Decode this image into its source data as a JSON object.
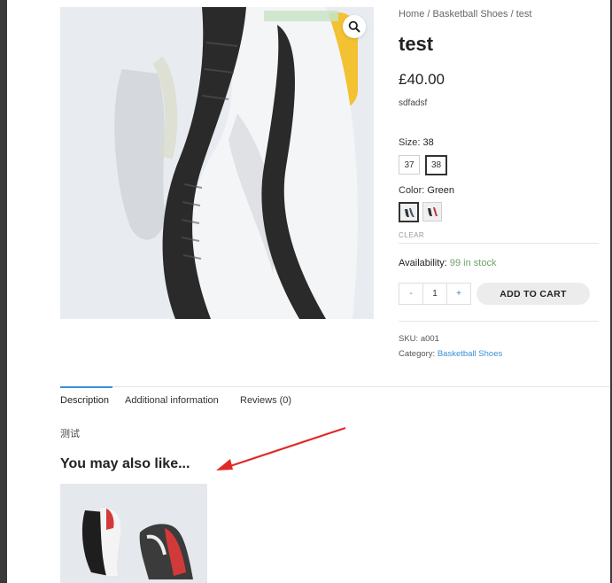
{
  "breadcrumb": {
    "home": "Home",
    "sep": "/",
    "category": "Basketball Shoes",
    "current": "test"
  },
  "product": {
    "title": "test",
    "price": "£40.00",
    "short_description": "sdfadsf",
    "size_label": "Size:",
    "size_selected": "38",
    "sizes": [
      "37",
      "38"
    ],
    "color_label": "Color:",
    "color_selected": "Green",
    "clear_label": "CLEAR",
    "availability_label": "Availability:",
    "availability_value": "99 in stock",
    "quantity": "1",
    "qty_minus": "-",
    "qty_plus": "+",
    "add_to_cart": "ADD TO CART",
    "sku_label": "SKU:",
    "sku_value": "a001",
    "category_label": "Category:",
    "category_value": "Basketball Shoes"
  },
  "tabs": {
    "description": "Description",
    "additional": "Additional information",
    "reviews": "Reviews (0)",
    "content": "测试"
  },
  "related": {
    "title": "You may also like..."
  },
  "colors": {
    "accent": "#3a8ee0",
    "stock": "#6fa46a",
    "annotation_arrow": "#e02a2a"
  },
  "icons": {
    "zoom": "magnifier-icon"
  }
}
